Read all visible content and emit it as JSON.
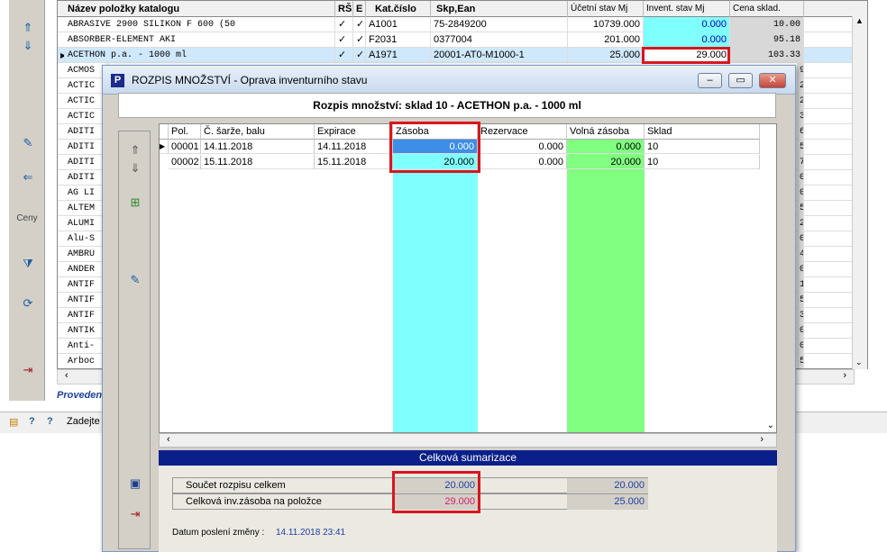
{
  "background_window": {
    "columns": [
      "Název položky katalogu",
      "RŠ",
      "E",
      "Kat.číslo",
      "Skp,Ean",
      "Účetní stav Mj",
      "Invent. stav Mj",
      "Cena sklad."
    ],
    "rows": [
      {
        "name": "ABRASIVE 2900 SILIKON F 600 (50",
        "rs": "✓",
        "e": "✓",
        "kat": "A1001",
        "ean": "75-2849200",
        "ucet": "10739.000",
        "invent": "0.000",
        "cena": "10.00"
      },
      {
        "name": "ABSORBER-ELEMENT AKI",
        "rs": "✓",
        "e": "✓",
        "kat": "F2031",
        "ean": "0377004",
        "ucet": "201.000",
        "invent": "0.000",
        "cena": "95.18"
      },
      {
        "name": "ACETHON p.a. - 1000 ml",
        "rs": "✓",
        "e": "✓",
        "kat": "A1971",
        "ean": "20001-AT0-M1000-1",
        "ucet": "25.000",
        "invent": "29.000",
        "cena": "103.33"
      }
    ],
    "truncated_names": [
      "ACMOS",
      "ACTIC",
      "ACTIC",
      "ACTIC",
      "ADITI",
      "ADITI",
      "ADITI",
      "ADITI",
      "AG LI",
      "ALTEM",
      "ALUMI",
      "Alu-S",
      "AMBRU",
      "ANDER",
      "ANTIF",
      "ANTIF",
      "ANTIF",
      "ANTIK",
      "Anti-",
      "Arboc"
    ],
    "price_tails": [
      "9",
      "2",
      "2",
      "3",
      "6",
      "5",
      "7",
      "0",
      "0",
      "5",
      "2",
      "0",
      "4",
      "0",
      "1",
      "5",
      "3",
      "0",
      "0",
      "5"
    ],
    "side_label": "Ceny",
    "status_text": "Provedeno",
    "bottom_bar_text": "Zadejte",
    "colors": {
      "cyan": "#80ffff",
      "selected_row": "#d0e8fb"
    }
  },
  "dialog": {
    "app_icon_letter": "P",
    "title": "ROZPIS MNOŽSTVÍ - Oprava inventurního stavu",
    "heading": "Rozpis množství: sklad 10 - ACETHON p.a. - 1000 ml",
    "grid": {
      "columns": [
        "Pol.",
        "Č. šarže, balu",
        "Expirace",
        "Zásoba",
        "Rezervace",
        "Volná zásoba",
        "Sklad"
      ],
      "rows": [
        {
          "pol": "00001",
          "sarze": "14.11.2018",
          "expirace": "14.11.2018",
          "zasoba": "0.000",
          "rezervace": "0.000",
          "volna": "0.000",
          "sklad": "10"
        },
        {
          "pol": "00002",
          "sarze": "15.11.2018",
          "expirace": "15.11.2018",
          "zasoba": "20.000",
          "rezervace": "0.000",
          "volna": "20.000",
          "sklad": "10"
        }
      ]
    },
    "summary": {
      "title": "Celková sumarizace",
      "rows": [
        {
          "label": "Součet rozpisu celkem",
          "value": "20.000",
          "value2": "20.000"
        },
        {
          "label": "Celková inv.zásoba na položce",
          "value": "29.000",
          "value2": "25.000"
        }
      ],
      "last_change_label": "Datum poslení změny :",
      "last_change_value": "14.11.2018 23:41"
    },
    "colors": {
      "highlight_red": "#d8161e",
      "green": "#80ff80",
      "summary_bar": "#0a1f8a"
    }
  }
}
